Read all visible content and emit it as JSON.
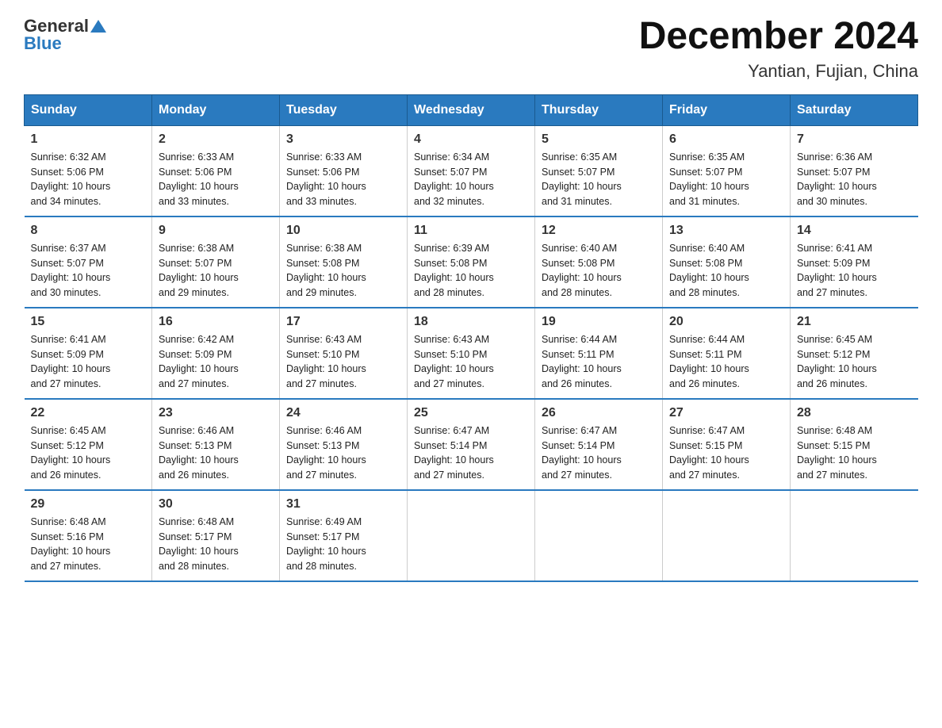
{
  "header": {
    "logo_general": "General",
    "logo_blue": "Blue",
    "month_title": "December 2024",
    "location": "Yantian, Fujian, China"
  },
  "days_of_week": [
    "Sunday",
    "Monday",
    "Tuesday",
    "Wednesday",
    "Thursday",
    "Friday",
    "Saturday"
  ],
  "weeks": [
    {
      "days": [
        {
          "num": "1",
          "sunrise": "6:32 AM",
          "sunset": "5:06 PM",
          "daylight": "10 hours and 34 minutes."
        },
        {
          "num": "2",
          "sunrise": "6:33 AM",
          "sunset": "5:06 PM",
          "daylight": "10 hours and 33 minutes."
        },
        {
          "num": "3",
          "sunrise": "6:33 AM",
          "sunset": "5:06 PM",
          "daylight": "10 hours and 33 minutes."
        },
        {
          "num": "4",
          "sunrise": "6:34 AM",
          "sunset": "5:07 PM",
          "daylight": "10 hours and 32 minutes."
        },
        {
          "num": "5",
          "sunrise": "6:35 AM",
          "sunset": "5:07 PM",
          "daylight": "10 hours and 31 minutes."
        },
        {
          "num": "6",
          "sunrise": "6:35 AM",
          "sunset": "5:07 PM",
          "daylight": "10 hours and 31 minutes."
        },
        {
          "num": "7",
          "sunrise": "6:36 AM",
          "sunset": "5:07 PM",
          "daylight": "10 hours and 30 minutes."
        }
      ]
    },
    {
      "days": [
        {
          "num": "8",
          "sunrise": "6:37 AM",
          "sunset": "5:07 PM",
          "daylight": "10 hours and 30 minutes."
        },
        {
          "num": "9",
          "sunrise": "6:38 AM",
          "sunset": "5:07 PM",
          "daylight": "10 hours and 29 minutes."
        },
        {
          "num": "10",
          "sunrise": "6:38 AM",
          "sunset": "5:08 PM",
          "daylight": "10 hours and 29 minutes."
        },
        {
          "num": "11",
          "sunrise": "6:39 AM",
          "sunset": "5:08 PM",
          "daylight": "10 hours and 28 minutes."
        },
        {
          "num": "12",
          "sunrise": "6:40 AM",
          "sunset": "5:08 PM",
          "daylight": "10 hours and 28 minutes."
        },
        {
          "num": "13",
          "sunrise": "6:40 AM",
          "sunset": "5:08 PM",
          "daylight": "10 hours and 28 minutes."
        },
        {
          "num": "14",
          "sunrise": "6:41 AM",
          "sunset": "5:09 PM",
          "daylight": "10 hours and 27 minutes."
        }
      ]
    },
    {
      "days": [
        {
          "num": "15",
          "sunrise": "6:41 AM",
          "sunset": "5:09 PM",
          "daylight": "10 hours and 27 minutes."
        },
        {
          "num": "16",
          "sunrise": "6:42 AM",
          "sunset": "5:09 PM",
          "daylight": "10 hours and 27 minutes."
        },
        {
          "num": "17",
          "sunrise": "6:43 AM",
          "sunset": "5:10 PM",
          "daylight": "10 hours and 27 minutes."
        },
        {
          "num": "18",
          "sunrise": "6:43 AM",
          "sunset": "5:10 PM",
          "daylight": "10 hours and 27 minutes."
        },
        {
          "num": "19",
          "sunrise": "6:44 AM",
          "sunset": "5:11 PM",
          "daylight": "10 hours and 26 minutes."
        },
        {
          "num": "20",
          "sunrise": "6:44 AM",
          "sunset": "5:11 PM",
          "daylight": "10 hours and 26 minutes."
        },
        {
          "num": "21",
          "sunrise": "6:45 AM",
          "sunset": "5:12 PM",
          "daylight": "10 hours and 26 minutes."
        }
      ]
    },
    {
      "days": [
        {
          "num": "22",
          "sunrise": "6:45 AM",
          "sunset": "5:12 PM",
          "daylight": "10 hours and 26 minutes."
        },
        {
          "num": "23",
          "sunrise": "6:46 AM",
          "sunset": "5:13 PM",
          "daylight": "10 hours and 26 minutes."
        },
        {
          "num": "24",
          "sunrise": "6:46 AM",
          "sunset": "5:13 PM",
          "daylight": "10 hours and 27 minutes."
        },
        {
          "num": "25",
          "sunrise": "6:47 AM",
          "sunset": "5:14 PM",
          "daylight": "10 hours and 27 minutes."
        },
        {
          "num": "26",
          "sunrise": "6:47 AM",
          "sunset": "5:14 PM",
          "daylight": "10 hours and 27 minutes."
        },
        {
          "num": "27",
          "sunrise": "6:47 AM",
          "sunset": "5:15 PM",
          "daylight": "10 hours and 27 minutes."
        },
        {
          "num": "28",
          "sunrise": "6:48 AM",
          "sunset": "5:15 PM",
          "daylight": "10 hours and 27 minutes."
        }
      ]
    },
    {
      "days": [
        {
          "num": "29",
          "sunrise": "6:48 AM",
          "sunset": "5:16 PM",
          "daylight": "10 hours and 27 minutes."
        },
        {
          "num": "30",
          "sunrise": "6:48 AM",
          "sunset": "5:17 PM",
          "daylight": "10 hours and 28 minutes."
        },
        {
          "num": "31",
          "sunrise": "6:49 AM",
          "sunset": "5:17 PM",
          "daylight": "10 hours and 28 minutes."
        },
        null,
        null,
        null,
        null
      ]
    }
  ],
  "labels": {
    "sunrise": "Sunrise:",
    "sunset": "Sunset:",
    "daylight": "Daylight:"
  }
}
